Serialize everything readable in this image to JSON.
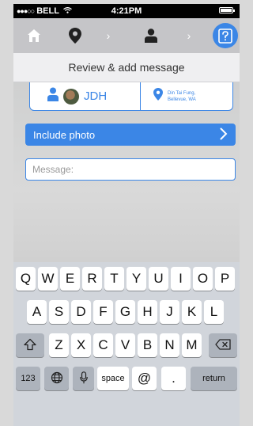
{
  "status_bar": {
    "carrier": "BELL",
    "time": "4:21PM",
    "battery_level": 1.0
  },
  "nav": {
    "icons": [
      "home-icon",
      "location-pin-icon",
      "person-icon",
      "help-icon"
    ]
  },
  "title": "Review & add message",
  "recipient": {
    "initials": "JDH",
    "location_line1": "Din Tai Fung,",
    "location_line2": "Bellevue, WA"
  },
  "include_photo_label": "Include photo",
  "message_placeholder": "Message:",
  "accent_color": "#3b86e6",
  "keyboard": {
    "row1": [
      "Q",
      "W",
      "E",
      "R",
      "T",
      "Y",
      "U",
      "I",
      "O",
      "P"
    ],
    "row2": [
      "A",
      "S",
      "D",
      "F",
      "G",
      "H",
      "J",
      "K",
      "L"
    ],
    "row3": [
      "Z",
      "X",
      "C",
      "V",
      "B",
      "N",
      "M"
    ],
    "key_123": "123",
    "key_space": "space",
    "key_at": "@",
    "key_dot": ".",
    "key_return": "return"
  }
}
